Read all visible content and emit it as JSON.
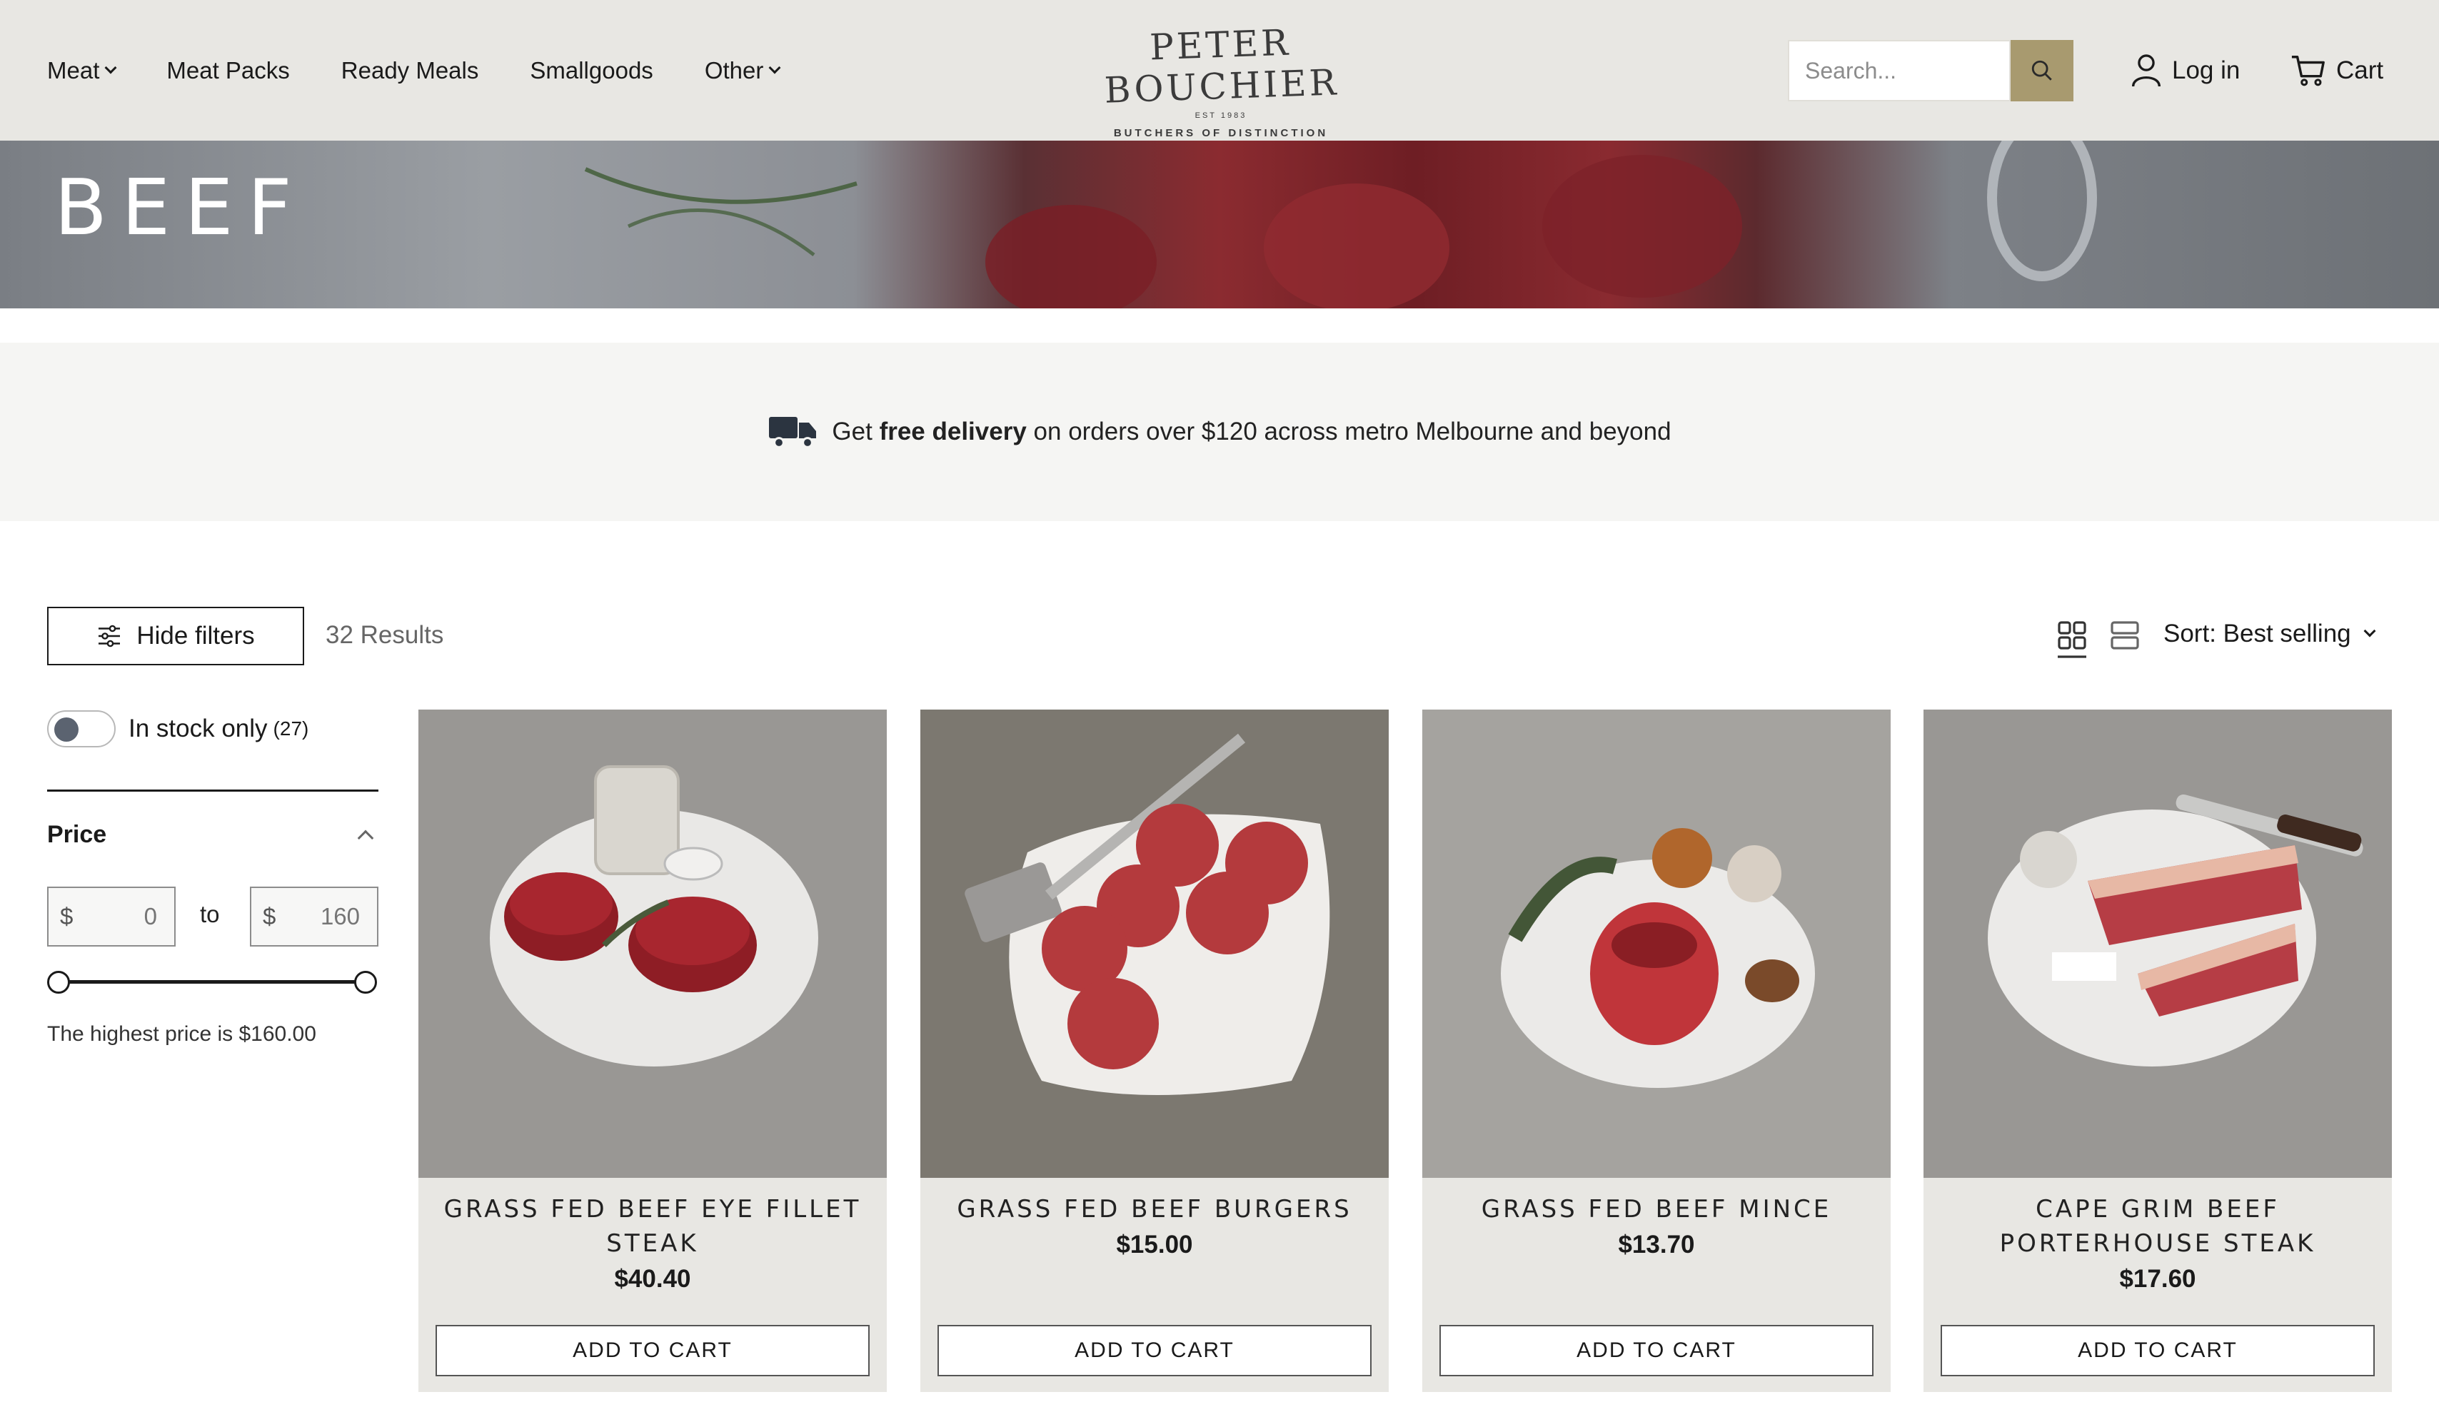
{
  "nav": {
    "items": [
      {
        "label": "Meat",
        "dropdown": true
      },
      {
        "label": "Meat Packs",
        "dropdown": false
      },
      {
        "label": "Ready Meals",
        "dropdown": false
      },
      {
        "label": "Smallgoods",
        "dropdown": false
      },
      {
        "label": "Other",
        "dropdown": true
      }
    ]
  },
  "logo": {
    "main": "PETER BOUCHIER",
    "est": "EST 1983",
    "sub": "BUTCHERS OF DISTINCTION"
  },
  "search": {
    "placeholder": "Search..."
  },
  "account": {
    "login": "Log in",
    "cart": "Cart"
  },
  "hero": {
    "title": "BEEF"
  },
  "delivery": {
    "prefix": "Get ",
    "bold": "free delivery",
    "suffix": " on orders over $120 across metro Melbourne and beyond"
  },
  "toolbar": {
    "filters": "Hide filters",
    "results": "32 Results",
    "sort": "Sort: Best selling"
  },
  "sidebar": {
    "stock_label": "In stock only",
    "stock_count": "(27)",
    "price_title": "Price",
    "currency": "$",
    "price_from_placeholder": "0",
    "price_to_placeholder": "160",
    "to": "to",
    "highest": "The highest price is $160.00"
  },
  "products": [
    {
      "name": "GRASS FED BEEF EYE FILLET STEAK",
      "price": "$40.40",
      "button": "ADD TO CART"
    },
    {
      "name": "GRASS FED BEEF BURGERS",
      "price": "$15.00",
      "button": "ADD TO CART"
    },
    {
      "name": "GRASS FED BEEF MINCE",
      "price": "$13.70",
      "button": "ADD TO CART"
    },
    {
      "name": "CAPE GRIM BEEF PORTERHOUSE STEAK",
      "price": "$17.60",
      "button": "ADD TO CART"
    }
  ],
  "colors": {
    "header_bg": "#e8e7e3",
    "accent": "#a89a6f",
    "card_bg": "#e8e7e3",
    "delivery_bg": "#f5f5f3"
  }
}
